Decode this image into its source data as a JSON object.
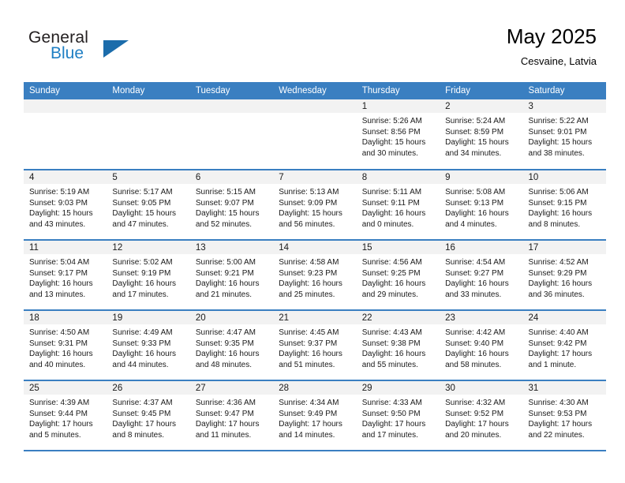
{
  "brand": {
    "line1": "General",
    "line2": "Blue",
    "triangle_color": "#1b6cab",
    "blue_color": "#1f7fc4",
    "logo_icon": "general-blue-triangle-icon"
  },
  "header": {
    "title": "May 2025",
    "subtitle": "Cesvaine, Latvia"
  },
  "theme": {
    "header_bg": "#3a7fc1",
    "header_text": "#ffffff",
    "daynum_band_bg": "#f2f2f2",
    "cell_bg": "#ffffff",
    "row_border": "#3a7fc1"
  },
  "columns": [
    "Sunday",
    "Monday",
    "Tuesday",
    "Wednesday",
    "Thursday",
    "Friday",
    "Saturday"
  ],
  "labels": {
    "sunrise_prefix": "Sunrise:",
    "sunset_prefix": "Sunset:",
    "daylight_prefix": "Daylight:"
  },
  "weeks": [
    [
      {
        "day": "",
        "sunrise": "",
        "sunset": "",
        "daylight_l1": "",
        "daylight_l2": ""
      },
      {
        "day": "",
        "sunrise": "",
        "sunset": "",
        "daylight_l1": "",
        "daylight_l2": ""
      },
      {
        "day": "",
        "sunrise": "",
        "sunset": "",
        "daylight_l1": "",
        "daylight_l2": ""
      },
      {
        "day": "",
        "sunrise": "",
        "sunset": "",
        "daylight_l1": "",
        "daylight_l2": ""
      },
      {
        "day": "1",
        "sunrise": "Sunrise: 5:26 AM",
        "sunset": "Sunset: 8:56 PM",
        "daylight_l1": "Daylight: 15 hours",
        "daylight_l2": "and 30 minutes."
      },
      {
        "day": "2",
        "sunrise": "Sunrise: 5:24 AM",
        "sunset": "Sunset: 8:59 PM",
        "daylight_l1": "Daylight: 15 hours",
        "daylight_l2": "and 34 minutes."
      },
      {
        "day": "3",
        "sunrise": "Sunrise: 5:22 AM",
        "sunset": "Sunset: 9:01 PM",
        "daylight_l1": "Daylight: 15 hours",
        "daylight_l2": "and 38 minutes."
      }
    ],
    [
      {
        "day": "4",
        "sunrise": "Sunrise: 5:19 AM",
        "sunset": "Sunset: 9:03 PM",
        "daylight_l1": "Daylight: 15 hours",
        "daylight_l2": "and 43 minutes."
      },
      {
        "day": "5",
        "sunrise": "Sunrise: 5:17 AM",
        "sunset": "Sunset: 9:05 PM",
        "daylight_l1": "Daylight: 15 hours",
        "daylight_l2": "and 47 minutes."
      },
      {
        "day": "6",
        "sunrise": "Sunrise: 5:15 AM",
        "sunset": "Sunset: 9:07 PM",
        "daylight_l1": "Daylight: 15 hours",
        "daylight_l2": "and 52 minutes."
      },
      {
        "day": "7",
        "sunrise": "Sunrise: 5:13 AM",
        "sunset": "Sunset: 9:09 PM",
        "daylight_l1": "Daylight: 15 hours",
        "daylight_l2": "and 56 minutes."
      },
      {
        "day": "8",
        "sunrise": "Sunrise: 5:11 AM",
        "sunset": "Sunset: 9:11 PM",
        "daylight_l1": "Daylight: 16 hours",
        "daylight_l2": "and 0 minutes."
      },
      {
        "day": "9",
        "sunrise": "Sunrise: 5:08 AM",
        "sunset": "Sunset: 9:13 PM",
        "daylight_l1": "Daylight: 16 hours",
        "daylight_l2": "and 4 minutes."
      },
      {
        "day": "10",
        "sunrise": "Sunrise: 5:06 AM",
        "sunset": "Sunset: 9:15 PM",
        "daylight_l1": "Daylight: 16 hours",
        "daylight_l2": "and 8 minutes."
      }
    ],
    [
      {
        "day": "11",
        "sunrise": "Sunrise: 5:04 AM",
        "sunset": "Sunset: 9:17 PM",
        "daylight_l1": "Daylight: 16 hours",
        "daylight_l2": "and 13 minutes."
      },
      {
        "day": "12",
        "sunrise": "Sunrise: 5:02 AM",
        "sunset": "Sunset: 9:19 PM",
        "daylight_l1": "Daylight: 16 hours",
        "daylight_l2": "and 17 minutes."
      },
      {
        "day": "13",
        "sunrise": "Sunrise: 5:00 AM",
        "sunset": "Sunset: 9:21 PM",
        "daylight_l1": "Daylight: 16 hours",
        "daylight_l2": "and 21 minutes."
      },
      {
        "day": "14",
        "sunrise": "Sunrise: 4:58 AM",
        "sunset": "Sunset: 9:23 PM",
        "daylight_l1": "Daylight: 16 hours",
        "daylight_l2": "and 25 minutes."
      },
      {
        "day": "15",
        "sunrise": "Sunrise: 4:56 AM",
        "sunset": "Sunset: 9:25 PM",
        "daylight_l1": "Daylight: 16 hours",
        "daylight_l2": "and 29 minutes."
      },
      {
        "day": "16",
        "sunrise": "Sunrise: 4:54 AM",
        "sunset": "Sunset: 9:27 PM",
        "daylight_l1": "Daylight: 16 hours",
        "daylight_l2": "and 33 minutes."
      },
      {
        "day": "17",
        "sunrise": "Sunrise: 4:52 AM",
        "sunset": "Sunset: 9:29 PM",
        "daylight_l1": "Daylight: 16 hours",
        "daylight_l2": "and 36 minutes."
      }
    ],
    [
      {
        "day": "18",
        "sunrise": "Sunrise: 4:50 AM",
        "sunset": "Sunset: 9:31 PM",
        "daylight_l1": "Daylight: 16 hours",
        "daylight_l2": "and 40 minutes."
      },
      {
        "day": "19",
        "sunrise": "Sunrise: 4:49 AM",
        "sunset": "Sunset: 9:33 PM",
        "daylight_l1": "Daylight: 16 hours",
        "daylight_l2": "and 44 minutes."
      },
      {
        "day": "20",
        "sunrise": "Sunrise: 4:47 AM",
        "sunset": "Sunset: 9:35 PM",
        "daylight_l1": "Daylight: 16 hours",
        "daylight_l2": "and 48 minutes."
      },
      {
        "day": "21",
        "sunrise": "Sunrise: 4:45 AM",
        "sunset": "Sunset: 9:37 PM",
        "daylight_l1": "Daylight: 16 hours",
        "daylight_l2": "and 51 minutes."
      },
      {
        "day": "22",
        "sunrise": "Sunrise: 4:43 AM",
        "sunset": "Sunset: 9:38 PM",
        "daylight_l1": "Daylight: 16 hours",
        "daylight_l2": "and 55 minutes."
      },
      {
        "day": "23",
        "sunrise": "Sunrise: 4:42 AM",
        "sunset": "Sunset: 9:40 PM",
        "daylight_l1": "Daylight: 16 hours",
        "daylight_l2": "and 58 minutes."
      },
      {
        "day": "24",
        "sunrise": "Sunrise: 4:40 AM",
        "sunset": "Sunset: 9:42 PM",
        "daylight_l1": "Daylight: 17 hours",
        "daylight_l2": "and 1 minute."
      }
    ],
    [
      {
        "day": "25",
        "sunrise": "Sunrise: 4:39 AM",
        "sunset": "Sunset: 9:44 PM",
        "daylight_l1": "Daylight: 17 hours",
        "daylight_l2": "and 5 minutes."
      },
      {
        "day": "26",
        "sunrise": "Sunrise: 4:37 AM",
        "sunset": "Sunset: 9:45 PM",
        "daylight_l1": "Daylight: 17 hours",
        "daylight_l2": "and 8 minutes."
      },
      {
        "day": "27",
        "sunrise": "Sunrise: 4:36 AM",
        "sunset": "Sunset: 9:47 PM",
        "daylight_l1": "Daylight: 17 hours",
        "daylight_l2": "and 11 minutes."
      },
      {
        "day": "28",
        "sunrise": "Sunrise: 4:34 AM",
        "sunset": "Sunset: 9:49 PM",
        "daylight_l1": "Daylight: 17 hours",
        "daylight_l2": "and 14 minutes."
      },
      {
        "day": "29",
        "sunrise": "Sunrise: 4:33 AM",
        "sunset": "Sunset: 9:50 PM",
        "daylight_l1": "Daylight: 17 hours",
        "daylight_l2": "and 17 minutes."
      },
      {
        "day": "30",
        "sunrise": "Sunrise: 4:32 AM",
        "sunset": "Sunset: 9:52 PM",
        "daylight_l1": "Daylight: 17 hours",
        "daylight_l2": "and 20 minutes."
      },
      {
        "day": "31",
        "sunrise": "Sunrise: 4:30 AM",
        "sunset": "Sunset: 9:53 PM",
        "daylight_l1": "Daylight: 17 hours",
        "daylight_l2": "and 22 minutes."
      }
    ]
  ]
}
